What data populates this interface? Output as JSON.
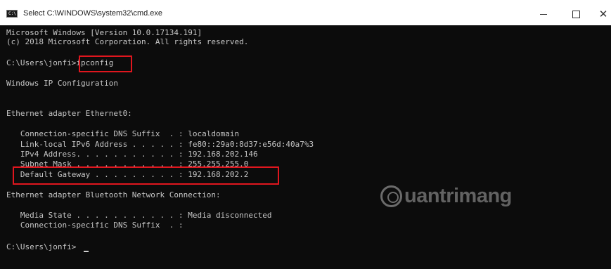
{
  "window": {
    "title": "Select C:\\WINDOWS\\system32\\cmd.exe",
    "app_icon_text": "C:\\",
    "controls": {
      "minimize": "",
      "maximize": "",
      "close": "✕"
    }
  },
  "console": {
    "lines": [
      "Microsoft Windows [Version 10.0.17134.191]",
      "(c) 2018 Microsoft Corporation. All rights reserved.",
      "C:\\Users\\jonfi>ipconfig",
      "Windows IP Configuration",
      "Ethernet adapter Ethernet0:",
      "   Connection-specific DNS Suffix  . : localdomain",
      "   Link-local IPv6 Address . . . . . : fe80::29a0:8d37:e56d:40a7%3",
      "   IPv4 Address. . . . . . . . . . . : 192.168.202.146",
      "   Subnet Mask . . . . . . . . . . . : 255.255.255.0",
      "   Default Gateway . . . . . . . . . : 192.168.202.2",
      "Ethernet adapter Bluetooth Network Connection:",
      "   Media State . . . . . . . . . . . : Media disconnected",
      "   Connection-specific DNS Suffix  . :",
      "C:\\Users\\jonfi>"
    ]
  },
  "watermark": {
    "text": "uantrimang"
  },
  "colors": {
    "console_bg": "#0c0c0c",
    "console_text": "#c6c6c6",
    "highlight": "#e0161e",
    "titlebar_bg": "#ffffff"
  }
}
